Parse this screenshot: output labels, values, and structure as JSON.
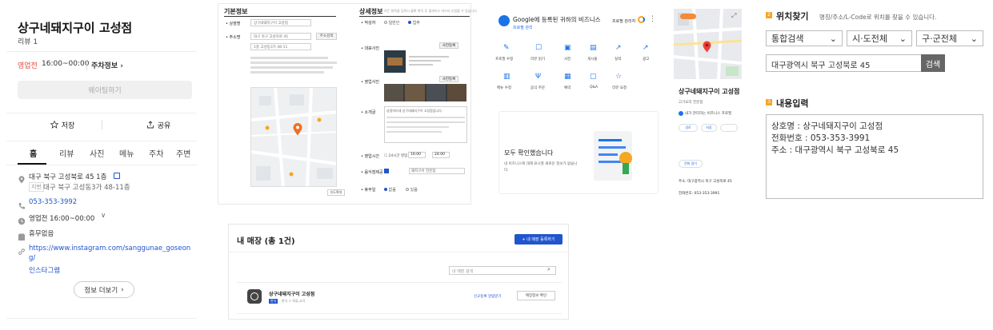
{
  "place": {
    "name": "상구네돼지구이 고성점",
    "category": "한식",
    "reviews": "리뷰 1",
    "status": "영업전",
    "hours": "16:00~00:00",
    "parking": "주차정보 ›",
    "waiting": "웨이팅하기",
    "save": "저장",
    "share": "공유",
    "tabs": [
      "홈",
      "리뷰",
      "사진",
      "메뉴",
      "주차",
      "주변"
    ],
    "address": "대구 북구 고성북로 45 1층",
    "jibun_tag": "지번",
    "jibun": "대구 북구 고성동3가 48-11층",
    "phone": "053-353-3992",
    "hours_row": "영업전 16:00~00:00",
    "holiday": "휴무없음",
    "instagram": "https://www.instagram.com/sanggunae_goseong/",
    "instagram_label": "인스타그램",
    "more": "정보 더보기"
  },
  "form": {
    "basic_title": "기본정보",
    "detail_title": "상세정보",
    "detail_note": "모든 항목을 입력시 블록 취득 후 플레이스 마스터 신청할 수 있습니다.",
    "store_label": "• 상점명",
    "store_value": "상구네돼지구이 고성점",
    "addr_label": "• 주소명",
    "addr_value": "대구 북구 고성북로 45",
    "addr_btn": "주소검색",
    "addr_detail": "1층 고성동3가 48-11",
    "write_label": "• 작성자",
    "radio1": "일반인",
    "radio2": "업주",
    "photo_label": "• 대표사진",
    "photo_btn": "사진등록",
    "photo_label2": "• 영업사진",
    "intro_label": "• 소개글",
    "intro_text": "상생하리새 상구네돼지구이 고성점입니다.",
    "hours_label": "• 영업시간",
    "hours_check": "24시간 영업",
    "from": "16:00",
    "to": "24:00",
    "cat_label": "• 음식점제공",
    "cat_value": "돼지구이 전문점",
    "holiday_label": "• 휴무일",
    "radio3": "없음",
    "radio4": "있음",
    "map_btn": "지도확대"
  },
  "biz": {
    "title": "Google에 등록된 귀하의 비즈니스",
    "sub": "프로필 관리",
    "manage": "프로필 관리자",
    "actions": [
      "프로필 수정",
      "리뷰 읽기",
      "사진",
      "게시물",
      "실적",
      "광고",
      "메뉴 수정",
      "음식 주문",
      "예약",
      "Q&A",
      "리뷰 요청"
    ],
    "done_title": "모두 확인했습니다",
    "done_text": "내 비즈니스에 대해 표시할 새로운 정보가 없습니다."
  },
  "gmap": {
    "name": "상구네돼지구이 고성점",
    "category": "고기요리 전문점",
    "claim": "내가 관리하는 비즈니스 프로필",
    "btn_route": "경로",
    "btn_save": "저장",
    "btn_call": "전화 걸기",
    "address": "주소: 대구광역시 북구 고성북로 45",
    "phone": "전화번호: 053-353-3991"
  },
  "loc": {
    "title": "위치찾기",
    "desc": "명칭/주소/L-Code로 위치를 찾을 수 있습니다.",
    "opt1": "통합검색",
    "opt2": "시·도전체",
    "opt3": "구·군전체",
    "query": "대구광역시 북구 고성북로 45",
    "search": "검색",
    "content_title": "내용입력",
    "content": [
      "상호명 : 상구네돼지구이 고성점",
      "전화번호 : 053-353-3991",
      "주소 : 대구광역시 북구 고성북로 45"
    ]
  },
  "store": {
    "title": "내 매장 (총 1건)",
    "add": "+ 내 매장 등록하기",
    "search_ph": "내 매장 검색",
    "name": "상구네돼지구이 고성점",
    "badge": "한식",
    "type": "한식 > 육류,고기",
    "link": "신규등록 알림받기",
    "info_btn": "매장정보 확인"
  },
  "colors": {
    "naver_red": "#e2483d",
    "blue": "#2155cd",
    "orange": "#f5a623",
    "google_blue": "#1a73e8"
  }
}
